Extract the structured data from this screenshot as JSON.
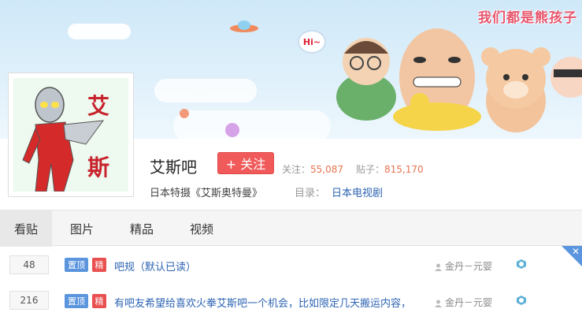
{
  "banner": {
    "slogan": "我们都是熊孩子",
    "bubble": "Hi~"
  },
  "avatar": {
    "text_top": "艾",
    "text_bottom": "斯"
  },
  "forum": {
    "name": "艾斯吧",
    "follow_label": "+ 关注",
    "followers_label": "关注：",
    "followers_value": "55,087",
    "posts_label": "贴子：",
    "posts_value": "815,170",
    "description": "日本特摄《艾斯奥特曼》",
    "category_label": "目录：",
    "category_value": "日本电视剧"
  },
  "tabs": [
    {
      "label": "看贴",
      "active": true
    },
    {
      "label": "图片",
      "active": false
    },
    {
      "label": "精品",
      "active": false
    },
    {
      "label": "视频",
      "active": false
    }
  ],
  "threads": [
    {
      "replies": "48",
      "tag_top": "置顶",
      "tag_good": "精",
      "title": "吧规（默认已读）",
      "author": "金丹－元婴"
    },
    {
      "replies": "216",
      "tag_top": "置顶",
      "tag_good": "精",
      "title": "有吧友希望给喜欢火拳艾斯吧一个机会，比如限定几天搬运内容，",
      "author": "金丹－元婴"
    }
  ],
  "colors": {
    "accent_blue": "#2d64b3",
    "follow_red": "#f05a5a",
    "tag_blue": "#5b95de",
    "tag_red": "#e95050",
    "stat_orange": "#e8734f"
  }
}
